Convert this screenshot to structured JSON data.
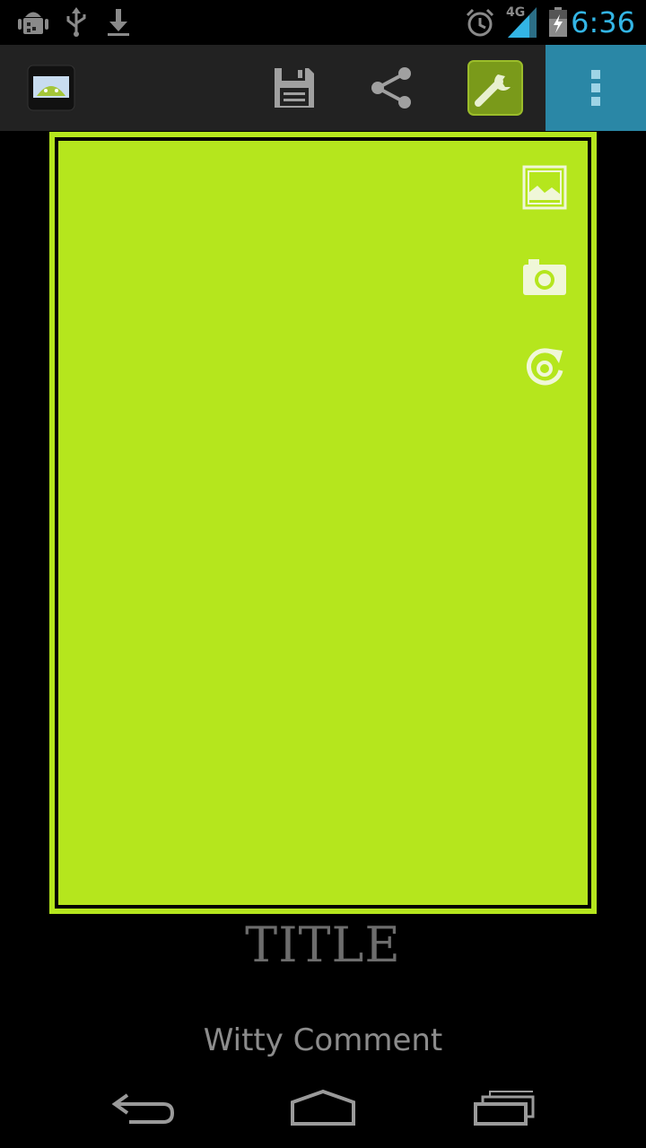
{
  "status_bar": {
    "time": "6:36",
    "network": "4G",
    "icons": [
      "android-debug-icon",
      "usb-icon",
      "download-icon",
      "alarm-icon",
      "signal-icon",
      "battery-charging-icon"
    ]
  },
  "action_bar": {
    "app_icon": "android-app-icon",
    "actions": [
      "save-icon",
      "share-icon",
      "wrench-icon"
    ],
    "overflow": "overflow-menu-icon"
  },
  "canvas": {
    "background_color": "#b5e61d",
    "tools": [
      "image-icon",
      "camera-icon",
      "rotate-icon"
    ]
  },
  "text": {
    "title": "TITLE",
    "comment": "Witty Comment"
  },
  "nav_bar": {
    "buttons": [
      "back-icon",
      "home-icon",
      "recent-apps-icon"
    ]
  },
  "colors": {
    "accent": "#33b5e5",
    "overflow_bg": "#2a87a6",
    "frame": "#b5e61d"
  }
}
